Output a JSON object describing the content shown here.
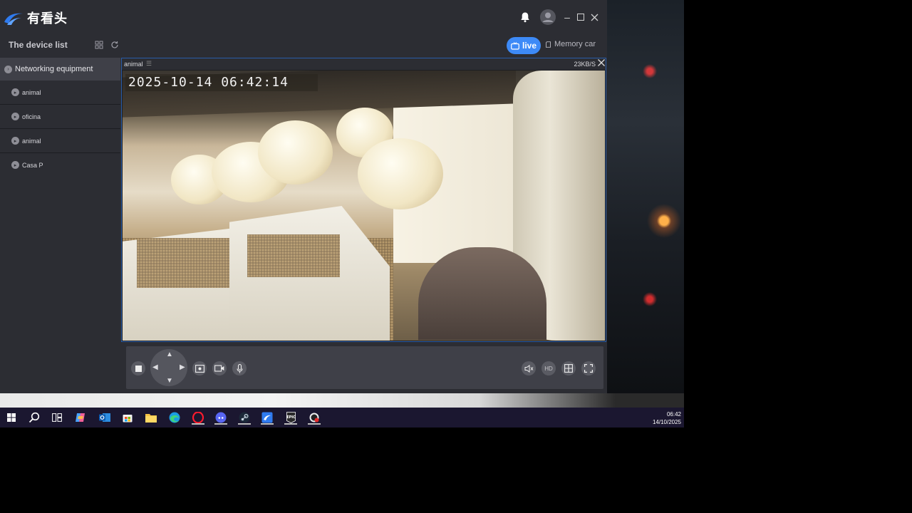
{
  "app": {
    "name": "有看头",
    "window_controls": [
      "minimize",
      "maximize",
      "close"
    ]
  },
  "header": {
    "device_list_title": "The device list",
    "live_label": "live",
    "memory_label": "Memory car"
  },
  "sidebar": {
    "group_label": "Networking equipment",
    "items": [
      {
        "label": "animal"
      },
      {
        "label": "oficina"
      },
      {
        "label": "animal"
      },
      {
        "label": "Casa P"
      }
    ]
  },
  "player": {
    "channel_name": "animal",
    "speed": "23KB/S",
    "osd_timestamp": "2025-10-14  06:42:14"
  },
  "controls": {
    "hd_label": "HD"
  },
  "taskbar": {
    "time": "06:42",
    "date": "14/10/2025",
    "icons": [
      "windows-start",
      "search",
      "task-view",
      "copilot",
      "outlook",
      "store",
      "file-explorer",
      "edge",
      "opera",
      "discord",
      "steam",
      "camera-app",
      "epic-games",
      "chrome-like"
    ]
  },
  "colors": {
    "accent": "#3d8af7",
    "panel": "#2c2d33",
    "selected_group": "#3f4048",
    "video_border": "#2a5da8"
  }
}
